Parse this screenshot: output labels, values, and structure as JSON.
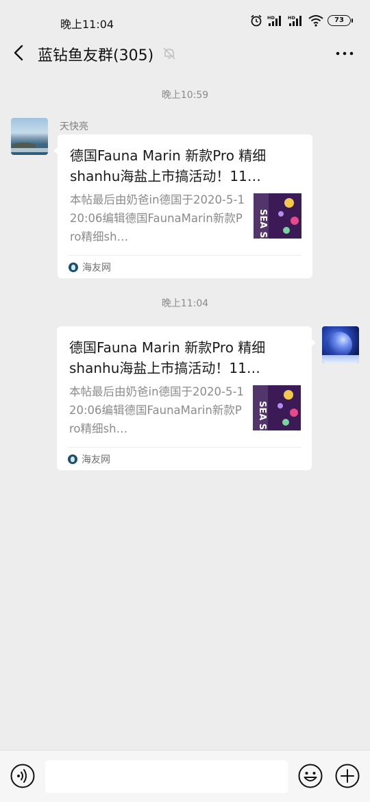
{
  "status_bar": {
    "time": "晚上11:04",
    "battery": "73",
    "network_label": "HD"
  },
  "header": {
    "title": "蓝钻鱼友群(305)"
  },
  "messages": [
    {
      "time_separator": "晚上10:59",
      "sender": "天快亮",
      "card": {
        "title": "德国Fauna Marin 新款Pro 精细shanhu海盐上市搞活动！11…",
        "description": "本帖最后由奶爸in德国于2020-5-120:06编辑德国FaunaMarin新款Pro精细sh…",
        "source": "海友网",
        "thumb_text": "SEA SALT"
      }
    },
    {
      "time_separator": "晚上11:04",
      "card": {
        "title": "德国Fauna Marin 新款Pro 精细shanhu海盐上市搞活动！11…",
        "description": "本帖最后由奶爸in德国于2020-5-120:06编辑德国FaunaMarin新款Pro精细sh…",
        "source": "海友网",
        "thumb_text": "SEA SALT"
      }
    }
  ],
  "colors": {
    "background": "#ededed",
    "card": "#ffffff",
    "muted_text": "#8b8b8b"
  }
}
